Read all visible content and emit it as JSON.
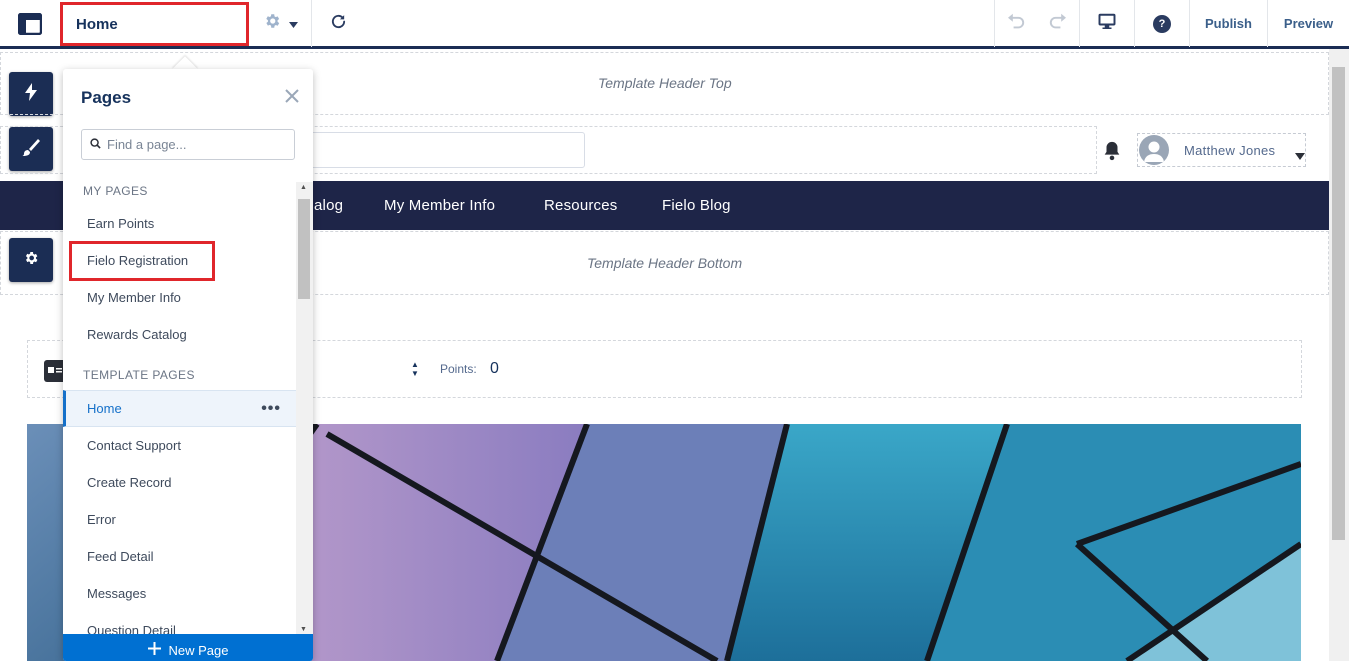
{
  "toolbar": {
    "current_page": "Home",
    "publish_label": "Publish",
    "preview_label": "Preview",
    "help_symbol": "?",
    "icons": [
      "app-layout-icon",
      "gear-icon",
      "chevron-down-icon",
      "refresh-icon",
      "undo-icon",
      "redo-icon",
      "desktop-icon",
      "help-icon"
    ]
  },
  "rail": {
    "icons": [
      "lightning-icon",
      "brush-icon",
      "list-icon",
      "gear-icon"
    ]
  },
  "canvas": {
    "header_top_label": "Template Header Top",
    "header_bottom_label": "Template Header Bottom",
    "user_name": "Matthew Jones",
    "nav_items": [
      "alog",
      "My Member Info",
      "Resources",
      "Fielo Blog"
    ],
    "points_label": "Points:",
    "points_value": "0"
  },
  "pages_panel": {
    "title": "Pages",
    "search_placeholder": "Find a page...",
    "my_pages_heading": "MY PAGES",
    "my_pages": [
      "Earn Points",
      "Fielo Registration",
      "My Member Info",
      "Rewards Catalog"
    ],
    "template_pages_heading": "TEMPLATE PAGES",
    "template_pages": [
      "Home",
      "Contact Support",
      "Create Record",
      "Error",
      "Feed Detail",
      "Messages",
      "Question Detail"
    ],
    "active_page": "Home",
    "new_page_label": "New Page"
  },
  "colors": {
    "brand_navy": "#1b2d54",
    "nav_bar": "#1e2548",
    "highlight_red": "#e0262b",
    "action_blue": "#0070d2"
  }
}
